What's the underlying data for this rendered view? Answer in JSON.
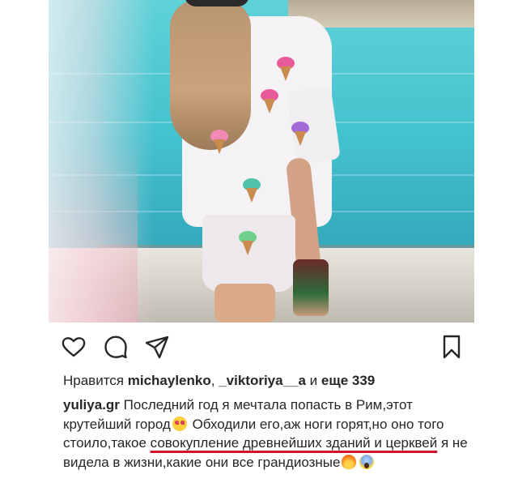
{
  "post": {
    "photo_alt": "photo",
    "icons": {
      "like": "heart-icon",
      "comment": "comment-bubble-icon",
      "share": "paper-plane-icon",
      "save": "bookmark-icon"
    },
    "likes": {
      "prefix": "Нравится ",
      "user1": "michaylenko",
      "sep": ", ",
      "user2": "_viktoriya__a",
      "middle": " и ",
      "others": "еще 339"
    },
    "caption": {
      "username": "yuliya.gr",
      "part1": " Последний год я мечтала попасть в Рим,этот крутейший город",
      "emoji1": "heart-eyes-cat-emoji",
      "part2": " Обходили его,аж ноги горят,но оно того стоило,такое ",
      "underlined": "совокупление древнейших зданий и церквей",
      "part3": " я не видела в жизни,какие они все грандиозные",
      "emoji2": "fire-emoji",
      "emoji3": "screaming-face-emoji",
      "underline_color": "#d3122a"
    }
  }
}
